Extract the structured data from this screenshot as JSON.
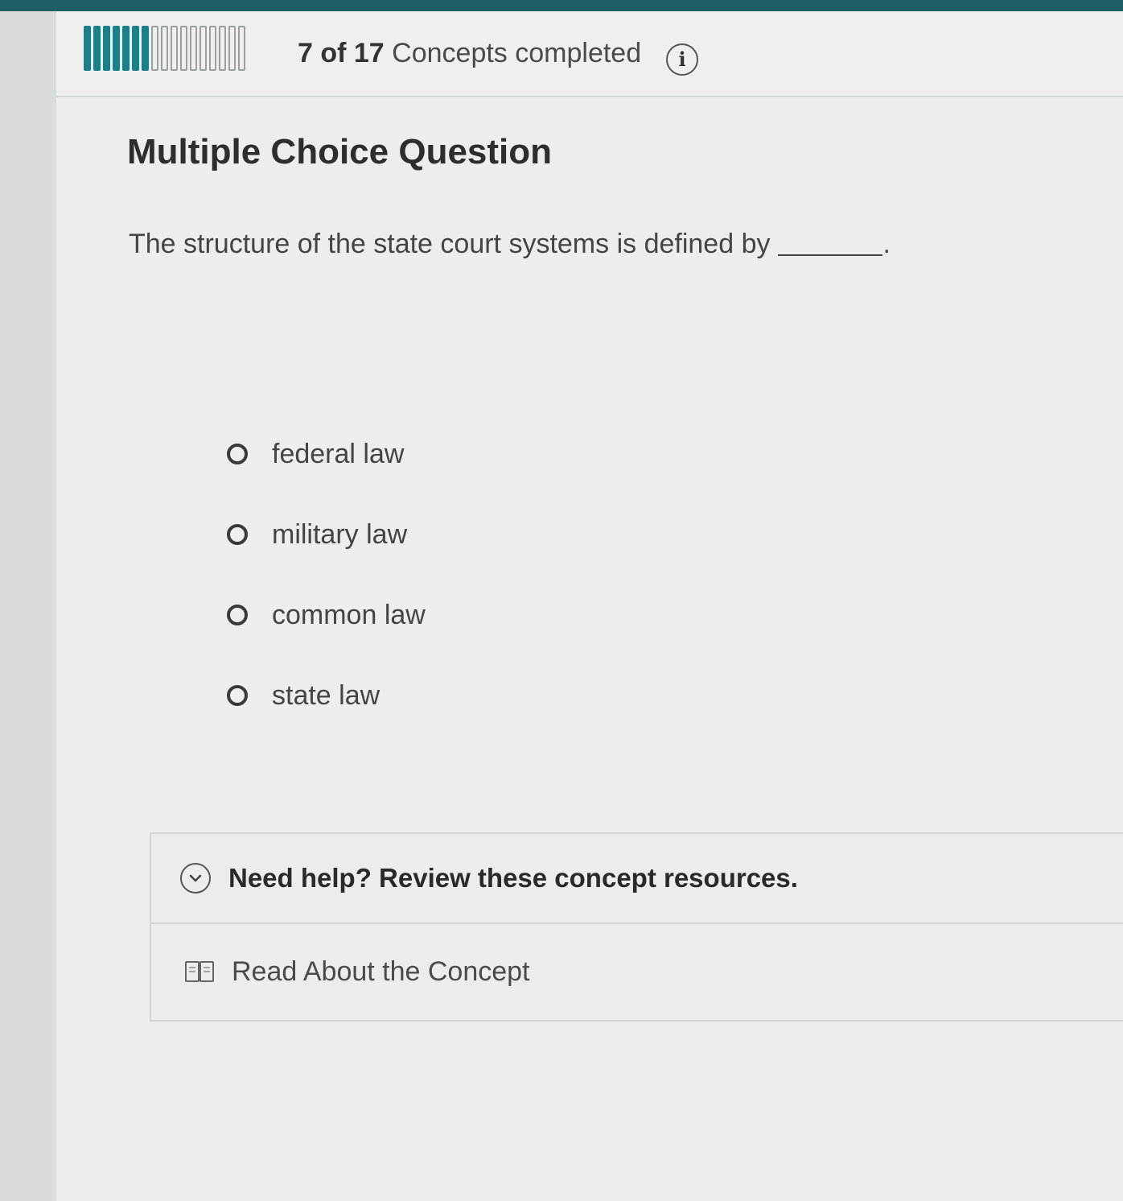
{
  "progress": {
    "completed": 7,
    "total": 17,
    "count_text": "7 of 17",
    "label_text": "Concepts completed",
    "info_icon": "info-icon",
    "info_glyph": "i"
  },
  "question": {
    "type_label": "Multiple Choice Question",
    "prompt_text": "The structure of the state court systems is defined by",
    "prompt_end": "."
  },
  "options": [
    {
      "label": "federal law"
    },
    {
      "label": "military law"
    },
    {
      "label": "common law"
    },
    {
      "label": "state law"
    }
  ],
  "help": {
    "title": "Need help? Review these concept resources.",
    "toggle_icon": "chevron-down-icon",
    "resources": [
      {
        "label": "Read About the Concept",
        "icon": "book-icon"
      }
    ]
  },
  "colors": {
    "accent": "#1f7f86",
    "top_bar": "#1f5f66"
  }
}
